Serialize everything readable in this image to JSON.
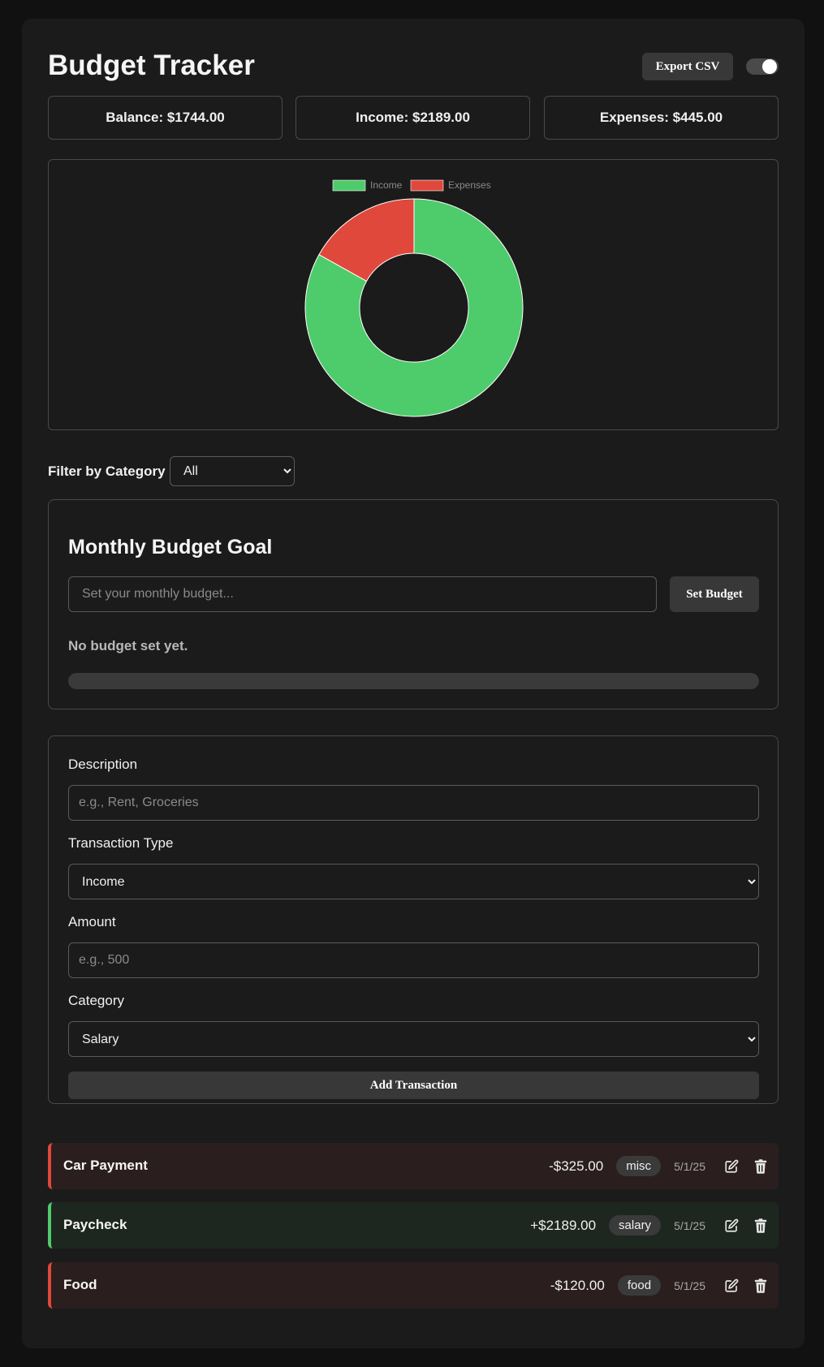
{
  "header": {
    "title": "Budget Tracker",
    "export_label": "Export CSV",
    "theme_toggle_on": true
  },
  "stats": {
    "balance": "Balance: $1744.00",
    "income": "Income: $2189.00",
    "expenses": "Expenses: $445.00"
  },
  "chart_data": {
    "type": "pie",
    "donut": true,
    "categories": [
      "Income",
      "Expenses"
    ],
    "values": [
      2189,
      445
    ],
    "colors": [
      "#4ecb6b",
      "#e0483b"
    ],
    "legend_position": "top"
  },
  "filter": {
    "label": "Filter by Category",
    "selected": "All"
  },
  "budget": {
    "title": "Monthly Budget Goal",
    "input_placeholder": "Set your monthly budget...",
    "button_label": "Set Budget",
    "status": "No budget set yet.",
    "progress": 0
  },
  "form": {
    "description_label": "Description",
    "description_placeholder": "e.g., Rent, Groceries",
    "type_label": "Transaction Type",
    "type_selected": "Income",
    "amount_label": "Amount",
    "amount_placeholder": "e.g., 500",
    "category_label": "Category",
    "category_selected": "Salary",
    "submit_label": "Add Transaction"
  },
  "transactions": [
    {
      "description": "Car Payment",
      "amount": "-$325.00",
      "category": "misc",
      "date": "5/1/25",
      "type": "expense"
    },
    {
      "description": "Paycheck",
      "amount": "+$2189.00",
      "category": "salary",
      "date": "5/1/25",
      "type": "income"
    },
    {
      "description": "Food",
      "amount": "-$120.00",
      "category": "food",
      "date": "5/1/25",
      "type": "expense"
    }
  ],
  "icons": {
    "edit": "edit-icon",
    "delete": "trash-icon"
  }
}
